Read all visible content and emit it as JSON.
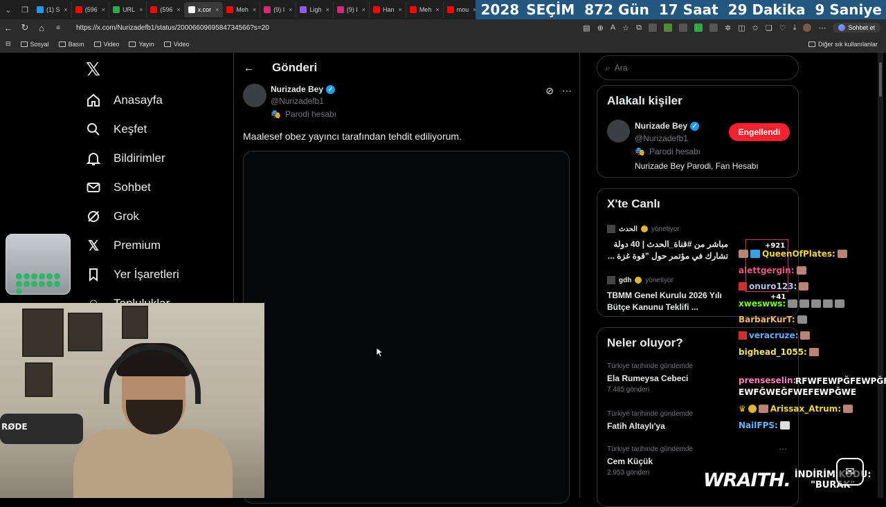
{
  "browser": {
    "tabs": [
      {
        "label": "(1) S",
        "color": "#1d9bf0"
      },
      {
        "label": "(596",
        "color": "#ff0000"
      },
      {
        "label": "URL",
        "color": "#2aa84a"
      },
      {
        "label": "(596",
        "color": "#ff0000"
      },
      {
        "label": "x.cor",
        "color": "#ffffff",
        "active": true
      },
      {
        "label": "Meh",
        "color": "#ff0000"
      },
      {
        "label": "(9) I",
        "color": "#d62976"
      },
      {
        "label": "Ligh",
        "color": "#8a5cf6"
      },
      {
        "label": "(9) I",
        "color": "#d62976"
      },
      {
        "label": "Han",
        "color": "#ff0000"
      },
      {
        "label": "Meh",
        "color": "#ff0000"
      },
      {
        "label": "mou",
        "color": "#ff0000"
      },
      {
        "label": "x.co",
        "color": "#ffffff"
      }
    ],
    "countdown": {
      "year": "2028",
      "label": "SEÇİM",
      "days": "872 Gün",
      "hours": "17 Saat",
      "minutes": "29 Dakika",
      "seconds": "9 Saniye"
    },
    "url": "https://x.com/Nurizadefb1/status/2000660969584734566?s=20",
    "chat_button": "Sohbet et",
    "bookmarks": [
      "Sosyal",
      "Basın",
      "Video",
      "Yayın",
      "Video"
    ],
    "bookmarks_other": "Diğer sık kullanılanlar"
  },
  "nav": {
    "items": [
      "Anasayfa",
      "Keşfet",
      "Bildirimler",
      "Sohbet",
      "Grok",
      "Premium",
      "Yer İşaretleri",
      "Topluluklar"
    ]
  },
  "post": {
    "header": "Gönderi",
    "author_name": "Nurizade Bey",
    "author_handle": "@Nurizadefb1",
    "parody": "Parodi hesabı",
    "text": "Maalesef obez yayıncı tarafından tehdit ediliyorum."
  },
  "sidebar": {
    "search_placeholder": "Ara",
    "related_title": "Alakalı kişiler",
    "related": {
      "name": "Nurizade Bey",
      "handle": "@Nurizadefb1",
      "parody": "Parodi hesabı",
      "bio": "Nurizade Bey Parodi, Fan Hesabı",
      "button": "Engellendi"
    },
    "live_title": "X'te Canlı",
    "live": [
      {
        "host": "الحدث",
        "role": "yönetiyor",
        "title": "مباشر من #قناة_الحدث | 40 دولة تشارك في مؤتمر حول \"قوة غزة ..."
      },
      {
        "host": "gdh",
        "role": "yönetiyor",
        "title": "TBMM Genel Kurulu 2026 Yılı Bütçe Kanunu Teklifi ..."
      }
    ],
    "trends_title": "Neler oluyor?",
    "trends": [
      {
        "meta": "Türkiye tarihinde gündemde",
        "name": "Ela Rumeysa Cebeci",
        "count": "7.485 gönderi"
      },
      {
        "meta": "Türkiye tarihinde gündemde",
        "name": "Fatih Altaylı'ya",
        "count": ""
      },
      {
        "meta": "Türkiye tarihinde gündemde",
        "name": "Cem Küçük",
        "count": "2.953 gönderi"
      }
    ]
  },
  "overlay": {
    "mic_label": "RØDE",
    "chat": {
      "plus1": "+921",
      "plus2": "+41",
      "messages": [
        {
          "user": "QueenOfPlates:",
          "text": "",
          "color": "#f0d14a"
        },
        {
          "user": "alettgergin:",
          "text": "",
          "color": "#e05a7a"
        },
        {
          "user": "onuro123:",
          "text": "",
          "color": "#b0c4de"
        },
        {
          "user": "xweswws:",
          "text": "",
          "color": "#7cfc00"
        },
        {
          "user": "BarbarKurT:",
          "text": "",
          "color": "#f2b86a"
        },
        {
          "user": "veracruze:",
          "text": "",
          "color": "#6aa8ff"
        },
        {
          "user": "bighead_1055:",
          "text": "",
          "color": "#f0e06a"
        },
        {
          "user": "prenseselin:",
          "text": "RFWFEWPĞFEWPĞF EWFĞWEĞFWEFEWPĞWE",
          "color": "#ff7fbf"
        },
        {
          "user": "Arissax_Atrum:",
          "text": "",
          "color": "#f0d14a"
        },
        {
          "user": "NailFPS:",
          "text": "",
          "color": "#6ab4ff"
        }
      ]
    },
    "promo": {
      "brand": "WRAITH.",
      "line1": "İNDİRİM KODU:",
      "line2": "\"BURAK\""
    }
  }
}
